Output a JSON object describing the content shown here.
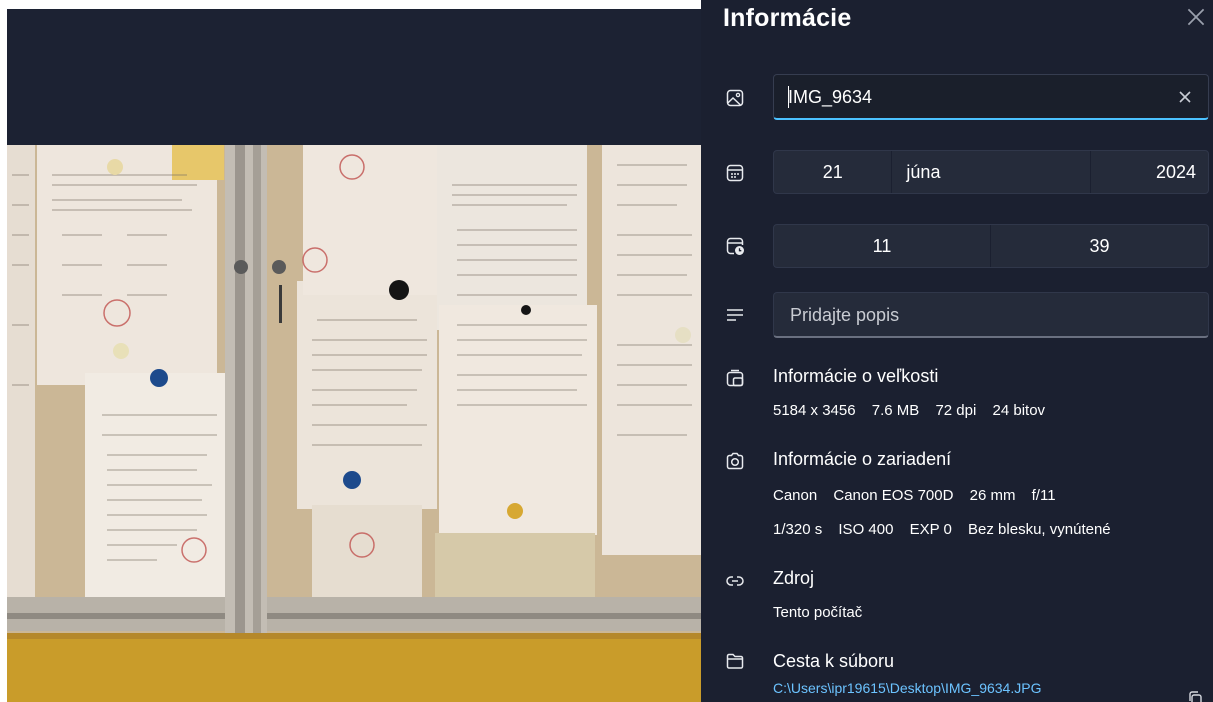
{
  "panel": {
    "title": "Informácie",
    "file_name": "IMG_9634",
    "date": {
      "day": "21",
      "month": "júna",
      "year": "2024"
    },
    "time": {
      "hour": "11",
      "minute": "39"
    },
    "description_placeholder": "Pridajte popis",
    "size_info": {
      "title": "Informácie o veľkosti",
      "dimensions": "5184 x 3456",
      "file_size": "7.6 MB",
      "dpi": "72 dpi",
      "bit_depth": "24 bitov"
    },
    "device_info": {
      "title": "Informácie o zariadení",
      "make": "Canon",
      "model": "Canon EOS 700D",
      "focal_length": "26 mm",
      "aperture": "f/11",
      "shutter": "1/320 s",
      "iso": "ISO 400",
      "exposure": "EXP 0",
      "flash": "Bez blesku, vynútené"
    },
    "source": {
      "title": "Zdroj",
      "value": "Tento počítač"
    },
    "path": {
      "title": "Cesta k súboru",
      "value": "C:\\Users\\ipr19615\\Desktop\\IMG_9634.JPG"
    }
  },
  "icons": {
    "close": "close-icon",
    "image": "image-icon",
    "calendar": "calendar-icon",
    "clock": "calendar-clock-icon",
    "description": "text-lines-icon",
    "size": "resize-icon",
    "camera": "camera-icon",
    "link": "link-icon",
    "folder": "folder-icon"
  },
  "colors": {
    "panel_bg": "#1b2030",
    "field_bg": "#252b3a",
    "accent": "#4cc2ff",
    "link": "#6cc3ff"
  }
}
